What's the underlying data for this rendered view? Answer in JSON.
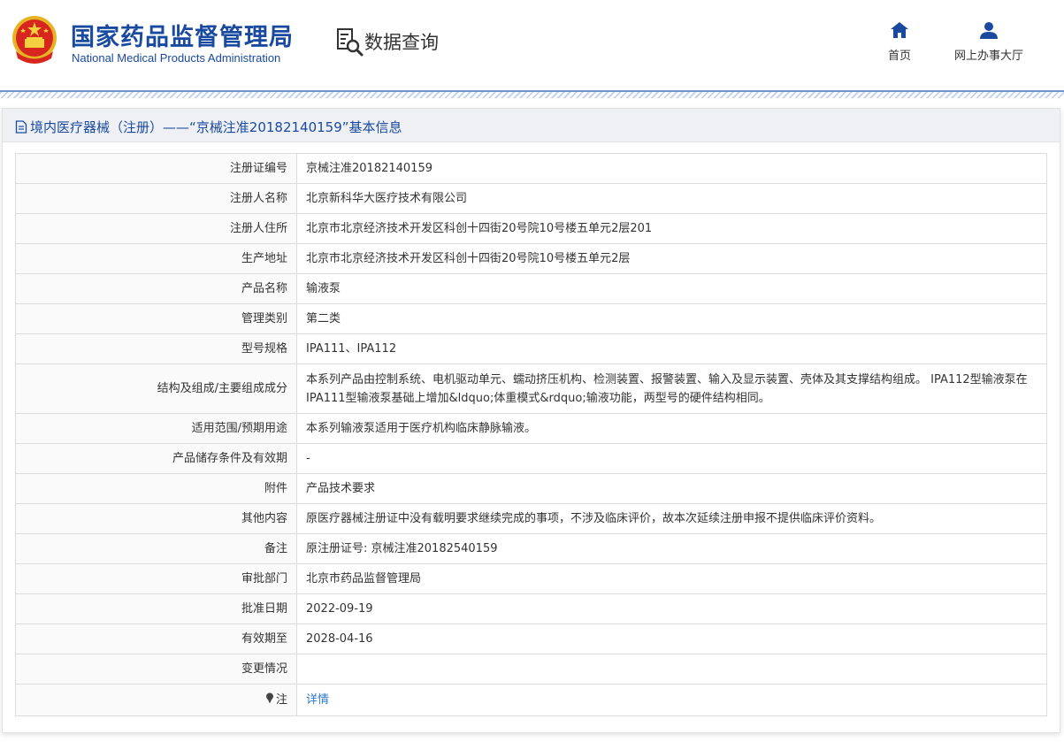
{
  "header": {
    "brand_cn": "国家药品监督管理局",
    "brand_en": "National Medical Products Administration",
    "query_label": "数据查询",
    "nav": [
      {
        "label": "首页",
        "icon": "home-icon"
      },
      {
        "label": "网上办事大厅",
        "icon": "user-icon"
      }
    ]
  },
  "panel": {
    "title": "境内医疗器械（注册）——“京械注准20182140159”基本信息",
    "title_icon": "document-icon"
  },
  "rows": [
    {
      "key": "注册证编号",
      "value": "京械注准20182140159"
    },
    {
      "key": "注册人名称",
      "value": "北京新科华大医疗技术有限公司"
    },
    {
      "key": "注册人住所",
      "value": "北京市北京经济技术开发区科创十四街20号院10号楼五单元2层201"
    },
    {
      "key": "生产地址",
      "value": "北京市北京经济技术开发区科创十四街20号院10号楼五单元2层"
    },
    {
      "key": "产品名称",
      "value": "输液泵"
    },
    {
      "key": "管理类别",
      "value": "第二类"
    },
    {
      "key": "型号规格",
      "value": "IPA111、IPA112"
    },
    {
      "key": "结构及组成/主要组成成分",
      "value": "本系列产品由控制系统、电机驱动单元、蠕动挤压机构、检测装置、报警装置、输入及显示装置、壳体及其支撑结构组成。 IPA112型输液泵在IPA111型输液泵基础上增加&ldquo;体重模式&rdquo;输液功能，两型号的硬件结构相同。"
    },
    {
      "key": "适用范围/预期用途",
      "value": "本系列输液泵适用于医疗机构临床静脉输液。"
    },
    {
      "key": "产品储存条件及有效期",
      "value": "-"
    },
    {
      "key": "附件",
      "value": "产品技术要求"
    },
    {
      "key": "其他内容",
      "value": "原医疗器械注册证中没有载明要求继续完成的事项，不涉及临床评价，故本次延续注册申报不提供临床评价资料。"
    },
    {
      "key": "备注",
      "value": "原注册证号: 京械注准20182540159"
    },
    {
      "key": "审批部门",
      "value": "北京市药品监督管理局"
    },
    {
      "key": "批准日期",
      "value": "2022-09-19"
    },
    {
      "key": "有效期至",
      "value": "2028-04-16"
    },
    {
      "key": "变更情况",
      "value": ""
    },
    {
      "key": "注",
      "value": "详情",
      "key_icon": "pin-icon"
    }
  ],
  "colors": {
    "brand": "#1a4aa0",
    "link": "#2a78c8",
    "rule": "#6e93c9"
  }
}
